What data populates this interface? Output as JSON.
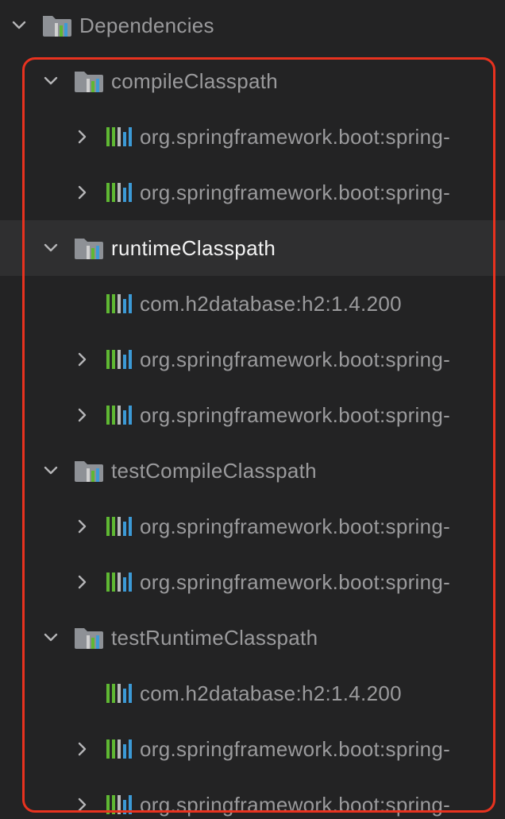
{
  "tree": {
    "root": {
      "label": "Dependencies",
      "expanded": true,
      "icon": "folder-gradle-icon"
    },
    "rows": [
      {
        "kind": "config",
        "label": "compileClasspath",
        "expanded": true,
        "selected": false
      },
      {
        "kind": "dep",
        "label": "org.springframework.boot:spring-",
        "expandable": true
      },
      {
        "kind": "dep",
        "label": "org.springframework.boot:spring-",
        "expandable": true
      },
      {
        "kind": "config",
        "label": "runtimeClasspath",
        "expanded": true,
        "selected": true
      },
      {
        "kind": "dep",
        "label": "com.h2database:h2:1.4.200",
        "expandable": false
      },
      {
        "kind": "dep",
        "label": "org.springframework.boot:spring-",
        "expandable": true
      },
      {
        "kind": "dep",
        "label": "org.springframework.boot:spring-",
        "expandable": true
      },
      {
        "kind": "config",
        "label": "testCompileClasspath",
        "expanded": true,
        "selected": false
      },
      {
        "kind": "dep",
        "label": "org.springframework.boot:spring-",
        "expandable": true
      },
      {
        "kind": "dep",
        "label": "org.springframework.boot:spring-",
        "expandable": true
      },
      {
        "kind": "config",
        "label": "testRuntimeClasspath",
        "expanded": true,
        "selected": false
      },
      {
        "kind": "dep",
        "label": "com.h2database:h2:1.4.200",
        "expandable": false
      },
      {
        "kind": "dep",
        "label": "org.springframework.boot:spring-",
        "expandable": true
      },
      {
        "kind": "dep",
        "label": "org.springframework.boot:spring-",
        "expandable": true
      }
    ]
  },
  "colors": {
    "background": "#232324",
    "selected_row": "#2f2f30",
    "text": "#9a9a9c",
    "text_selected": "#f2f2f2",
    "highlight": "#e8321f",
    "library_bar_green": "#5fb833",
    "library_bar_blue": "#3c9ad6",
    "folder": "#8e9196"
  }
}
